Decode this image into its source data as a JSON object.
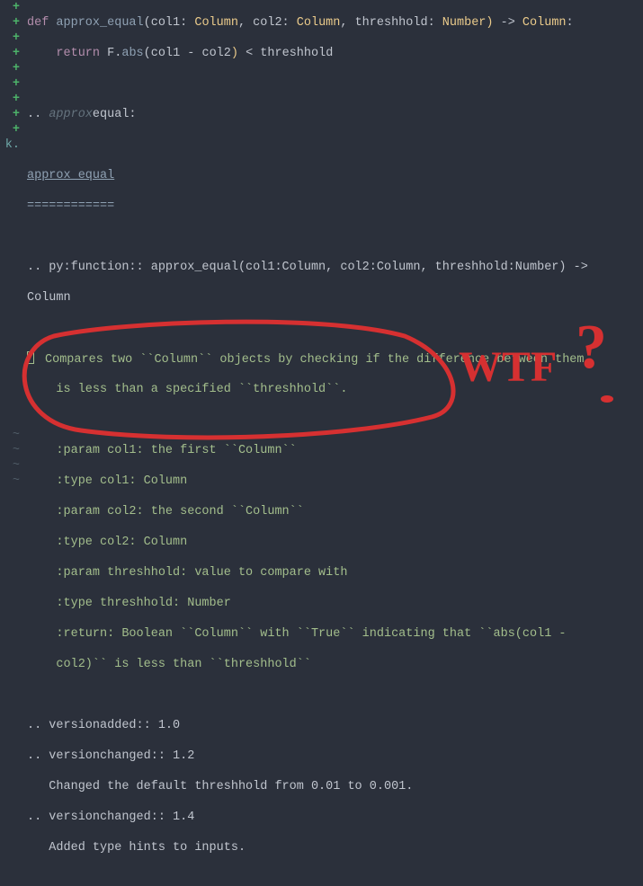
{
  "gutter": {
    "plus": "+",
    "k": "k.",
    "tilde": "~"
  },
  "code": {
    "l0": {
      "def": "def ",
      "fn": "approx_equal",
      "open": "(",
      "p1": "col1: ",
      "t1": "Column",
      "c1": ", ",
      "p2": "col2: ",
      "t2": "Column",
      "c2": ", ",
      "p3": "threshhold: ",
      "t3": "Number",
      "close": ") ",
      "arrow": "-> ",
      "ret": "Column",
      "colon": ":"
    },
    "l1": {
      "indent": "    ",
      "ret": "return ",
      "F": "F",
      "dot": ".",
      "abs": "abs",
      "open": "(",
      "a": "col1 ",
      "op": "- ",
      "b": "col2",
      "close": ") ",
      "lt": "< ",
      "th": "threshhold"
    },
    "l3": {
      "dots": ".. ",
      "ital": "approx",
      "rest": "equal:"
    },
    "l5": {
      "heading": "approx_equal"
    },
    "l6": {
      "uline": "============"
    },
    "l8": {
      "a": ".. py:function:: approx_equal(col1:Column, col2:Column, threshhold:Number) -> "
    },
    "l9": {
      "a": "Column"
    },
    "l11": {
      "a": "Compares two ``Column`` objects by checking if the difference between them"
    },
    "l12": {
      "a": "is less than a specified ``threshhold``."
    },
    "l14": {
      "a": ":param col1: the first ``Column``"
    },
    "l15": {
      "a": ":type col1: Column"
    },
    "l16": {
      "a": ":param col2: the second ``Column``"
    },
    "l17": {
      "a": ":type col2: Column"
    },
    "l18": {
      "a": ":param threshhold: value to compare with"
    },
    "l19": {
      "a": ":type threshhold: Number"
    },
    "l20": {
      "a": ":return: Boolean ``Column`` with ``True`` indicating that ``abs(col1 -"
    },
    "l21": {
      "a": "col2)`` is less than ``threshhold``"
    },
    "l23": {
      "a": ".. versionadded:: 1.0"
    },
    "l24": {
      "a": ".. versionchanged:: 1.2"
    },
    "l25": {
      "a": "   Changed the default threshhold from 0.01 to 0.001."
    },
    "l26": {
      "a": ".. versionchanged:: 1.4"
    },
    "l27": {
      "a": "   Added type hints to inputs."
    }
  },
  "annotation": {
    "text": "WTF",
    "qmark": "?"
  }
}
